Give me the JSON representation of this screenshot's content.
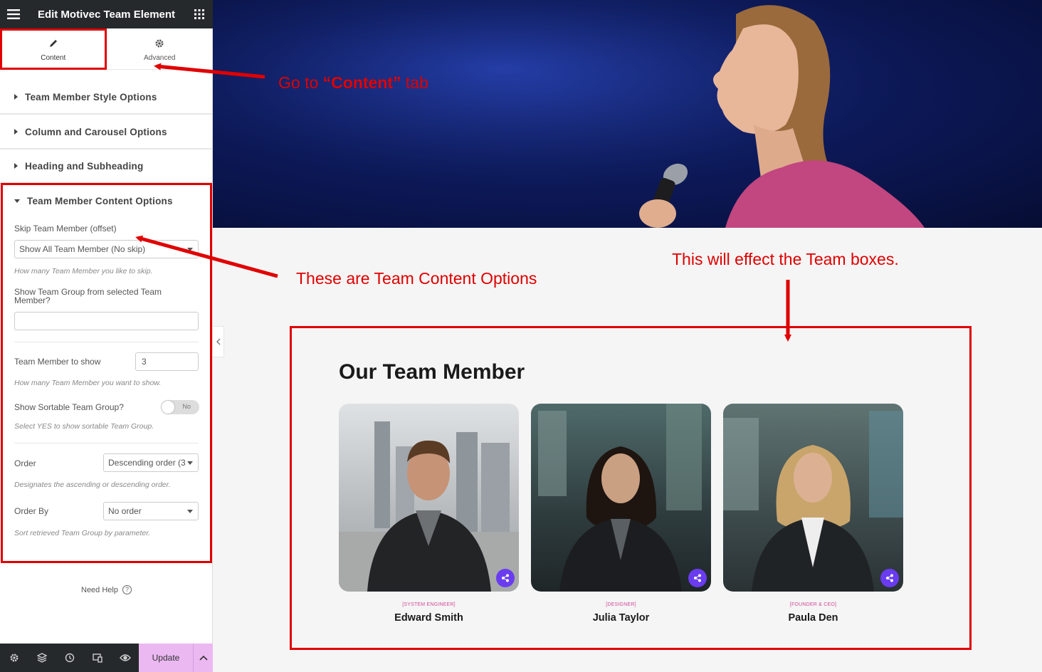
{
  "sidebar": {
    "title": "Edit Motivec Team Element",
    "tabs": [
      {
        "label": "Content",
        "icon": "pencil-icon"
      },
      {
        "label": "Advanced",
        "icon": "gear-icon"
      }
    ],
    "sections": [
      {
        "label": "Team Member Style Options"
      },
      {
        "label": "Column and Carousel Options"
      },
      {
        "label": "Heading and Subheading"
      },
      {
        "label": "Team Member Content Options"
      }
    ],
    "controls": {
      "skip_label": "Skip Team Member (offset)",
      "skip_value": "Show All Team Member (No skip)",
      "skip_help": "How many Team Member you like to skip.",
      "group_label": "Show Team Group from selected Team Member?",
      "group_value": "",
      "count_label": "Team Member to show",
      "count_value": "3",
      "count_help": "How many Team Member you want to show.",
      "sortable_label": "Show Sortable Team Group?",
      "sortable_value": "No",
      "sortable_help": "Select YES to show sortable Team Group.",
      "order_label": "Order",
      "order_value": "Descending order (3",
      "order_help": "Designates the ascending or descending order.",
      "orderby_label": "Order By",
      "orderby_value": "No order",
      "orderby_help": "Sort retrieved Team Group by parameter."
    },
    "need_help": "Need Help",
    "update_label": "Update"
  },
  "preview": {
    "heading": "Our Team Member",
    "members": [
      {
        "role": "[SYSTEM ENGINEER]",
        "name": "Edward Smith"
      },
      {
        "role": "[DESIGNER]",
        "name": "Julia Taylor"
      },
      {
        "role": "[FOUNDER & CEO]",
        "name": "Paula Den"
      }
    ]
  },
  "annotations": {
    "content_tab_pre": "Go  to ",
    "content_tab_bold": "“Content”",
    "content_tab_post": " tab",
    "options": "These are Team Content Options",
    "effect": "This will effect the Team boxes."
  },
  "colors": {
    "highlight": "#e00000",
    "accent": "#6a3cf0",
    "update_bg": "#ebb8f2",
    "topbar_bg": "#26292c"
  }
}
